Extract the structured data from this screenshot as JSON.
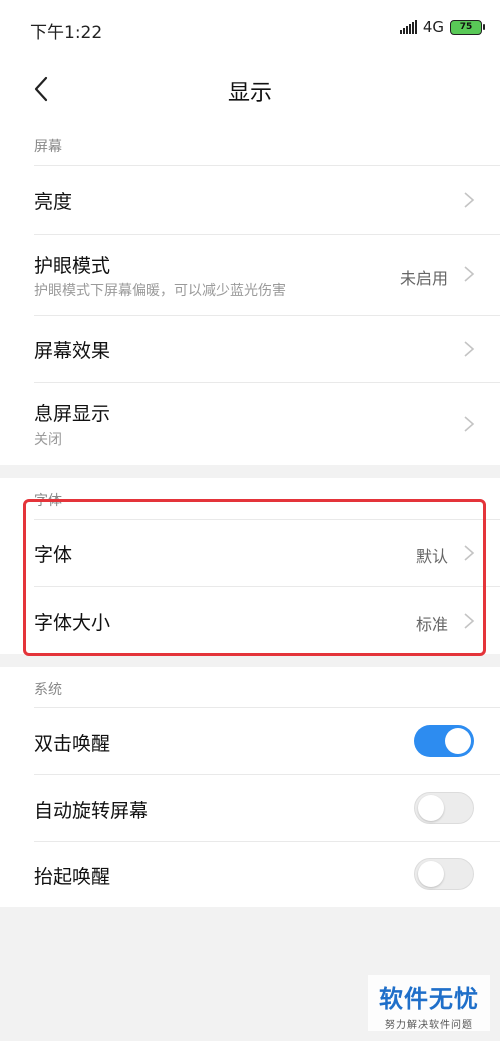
{
  "status_bar": {
    "time": "下午1:22",
    "network": "4G",
    "battery": "75"
  },
  "header": {
    "title": "显示"
  },
  "screen_section": {
    "label": "屏幕",
    "rows": [
      {
        "title": "亮度"
      },
      {
        "title": "护眼模式",
        "subtitle": "护眼模式下屏幕偏暖，可以减少蓝光伤害",
        "value": "未启用"
      },
      {
        "title": "屏幕效果"
      },
      {
        "title": "息屏显示",
        "subtitle": "关闭"
      }
    ]
  },
  "font_section": {
    "label": "字体",
    "rows": [
      {
        "title": "字体",
        "value": "默认"
      },
      {
        "title": "字体大小",
        "value": "标准"
      }
    ]
  },
  "system_section": {
    "label": "系统",
    "rows": [
      {
        "title": "双击唤醒",
        "toggle_on": true
      },
      {
        "title": "自动旋转屏幕",
        "toggle_on": false
      },
      {
        "title": "抬起唤醒",
        "toggle_on": false
      }
    ]
  },
  "watermark": {
    "main": "软件无忧",
    "sub": "努力解决软件问题"
  },
  "colors": {
    "accent": "#2d8cf0",
    "highlight": "#e4343a"
  }
}
